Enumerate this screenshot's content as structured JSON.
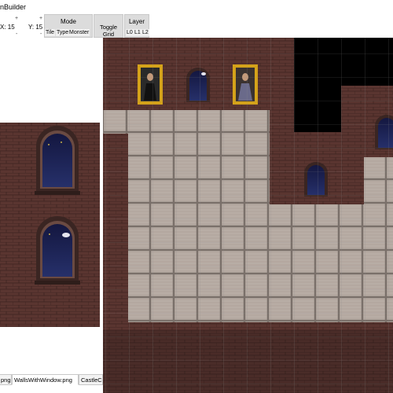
{
  "window": {
    "title": "nBuilder"
  },
  "toolbar": {
    "x_label": "X: 15",
    "y_label": "Y: 15",
    "spin_up": "+",
    "spin_down": "-",
    "mode_label": "Mode",
    "mode_options": [
      "Tile",
      "Type",
      "Monster"
    ],
    "toggle_grid_label": "Toggle Grid",
    "layer_label": "Layer",
    "layer_options": [
      "L0",
      "L1",
      "L2"
    ]
  },
  "tabs": [
    {
      "label": "png",
      "active": false
    },
    {
      "label": "WallsWithWindow.png",
      "active": true
    },
    {
      "label": "CastleC",
      "active": false
    }
  ],
  "colors": {
    "brick": "#5a3530",
    "brick_dark": "#3a2420",
    "floor": "#b9aea6",
    "void": "#000000",
    "window": "#1a1d4a",
    "frame": "#d4a21a"
  }
}
